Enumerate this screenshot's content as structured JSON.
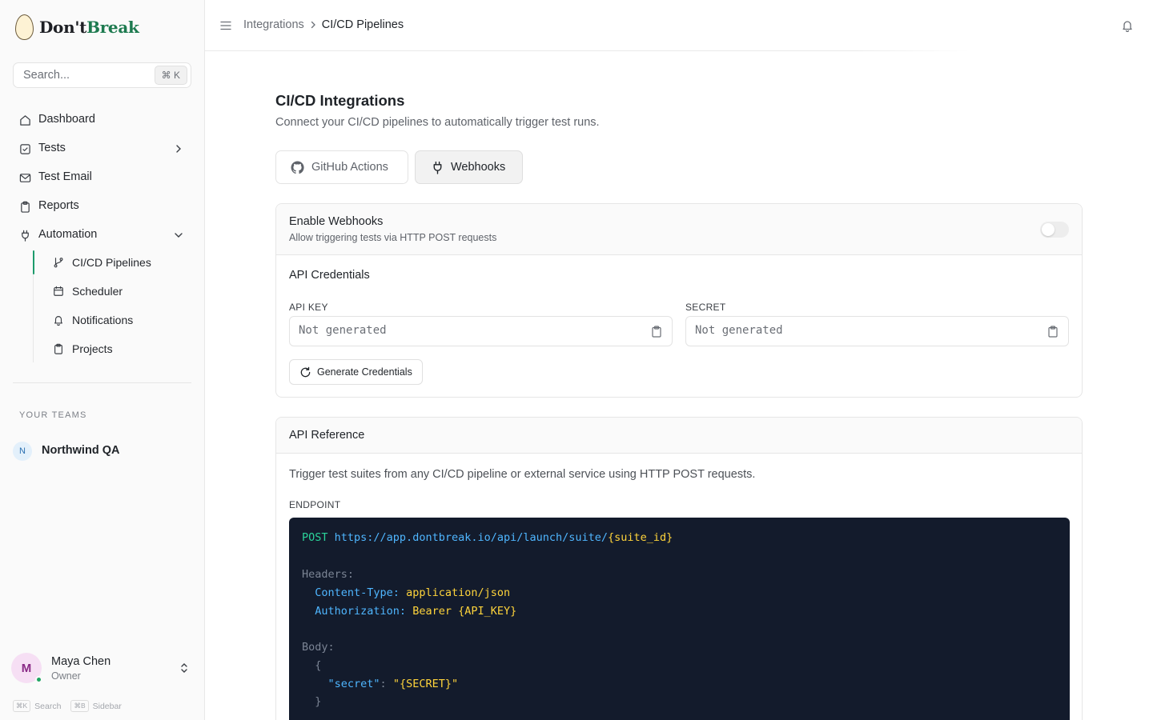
{
  "brand": {
    "name_part1": "Don't",
    "name_part2": "Break"
  },
  "search": {
    "placeholder": "Search...",
    "shortcut": "⌘ K"
  },
  "sidebar": {
    "items": [
      {
        "label": "Dashboard",
        "icon": "home-icon"
      },
      {
        "label": "Tests",
        "icon": "checkbox-icon"
      },
      {
        "label": "Test Email",
        "icon": "mail-icon"
      },
      {
        "label": "Reports",
        "icon": "clipboard-icon"
      },
      {
        "label": "Automation",
        "icon": "plug-icon"
      }
    ],
    "automation_subitems": [
      {
        "label": "CI/CD Pipelines",
        "icon": "git-branch-icon",
        "active": true
      },
      {
        "label": "Scheduler",
        "icon": "calendar-icon"
      },
      {
        "label": "Notifications",
        "icon": "bell-icon"
      },
      {
        "label": "Projects",
        "icon": "clipboard-icon"
      }
    ],
    "teams_heading": "YOUR TEAMS",
    "team": {
      "initial": "N",
      "name": "Northwind QA"
    },
    "user": {
      "initial": "M",
      "name": "Maya Chen",
      "role": "Owner",
      "status": "online"
    },
    "hints": [
      {
        "key": "⌘K",
        "label": "Search"
      },
      {
        "key": "⌘B",
        "label": "Sidebar"
      }
    ]
  },
  "breadcrumb": {
    "parent": "Integrations",
    "current": "CI/CD Pipelines"
  },
  "page": {
    "title": "CI/CD Integrations",
    "subtitle": "Connect your CI/CD pipelines to automatically trigger test runs."
  },
  "tabs": [
    {
      "label": "GitHub Actions",
      "icon": "github-icon",
      "active": false
    },
    {
      "label": "Webhooks",
      "icon": "plug-icon",
      "active": true
    }
  ],
  "webhooks": {
    "enable_title": "Enable Webhooks",
    "enable_desc": "Allow triggering tests via HTTP POST requests",
    "enabled": false,
    "credentials_title": "API Credentials",
    "api_key_label": "API KEY",
    "api_key_placeholder": "Not generated",
    "secret_label": "SECRET",
    "secret_placeholder": "Not generated",
    "generate_label": "Generate Credentials"
  },
  "api_reference": {
    "title": "API Reference",
    "description": "Trigger test suites from any CI/CD pipeline or external service using HTTP POST requests.",
    "endpoint_label": "ENDPOINT",
    "code": {
      "method": "POST",
      "url": "https://app.dontbreak.io/api/launch/suite/",
      "url_param": "{suite_id}",
      "headers_label": "Headers:",
      "header1_key": "Content-Type:",
      "header1_val": "application/json",
      "header2_key": "Authorization:",
      "header2_val": "Bearer {API_KEY}",
      "body_label": "Body:",
      "brace_open": "{",
      "body_key": "\"secret\"",
      "body_colon": ":",
      "body_val": "\"{SECRET}\"",
      "brace_close": "}"
    }
  },
  "colors": {
    "accent": "#1d9b6c",
    "brand_green": "#1d7a4f",
    "code_bg": "#131b2c",
    "code_method": "#2bd39a",
    "code_url": "#4fb6ff",
    "code_var": "#ffd43b"
  }
}
